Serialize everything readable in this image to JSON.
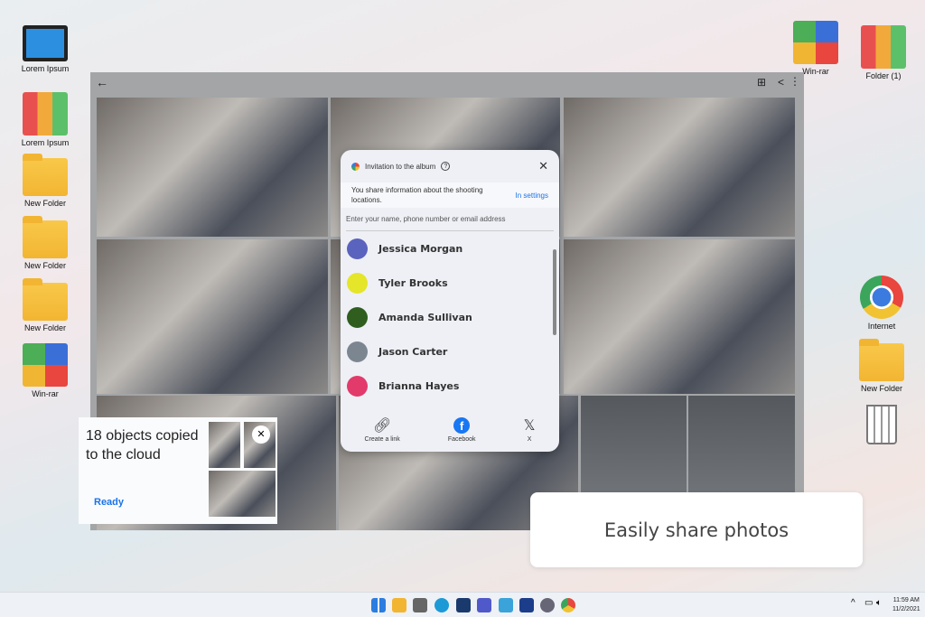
{
  "desktop": {
    "left": [
      {
        "label": "Lorem Ipsum",
        "icon": "computer-icon"
      },
      {
        "label": "Lorem Ipsum",
        "icon": "binders-icon"
      },
      {
        "label": "New Folder",
        "icon": "folder-icon"
      },
      {
        "label": "New Folder",
        "icon": "folder-icon"
      },
      {
        "label": "New Folder",
        "icon": "folder-icon"
      },
      {
        "label": "Win-rar",
        "icon": "winrar-icon"
      }
    ],
    "right": [
      {
        "label": "Win-rar"
      },
      {
        "label": "Folder (1)"
      },
      {
        "label": "Internet"
      },
      {
        "label": "New Folder"
      }
    ]
  },
  "dialog": {
    "title": "Invitation to the album",
    "info": "You share information about the shooting locations.",
    "settings_link": "In settings",
    "input_placeholder": "Enter your name, phone number or email address",
    "contacts": [
      {
        "name": "Jessica Morgan",
        "color": "#5a63bd"
      },
      {
        "name": "Tyler Brooks",
        "color": "#e5e52a"
      },
      {
        "name": "Amanda Sullivan",
        "color": "#2f5e1e"
      },
      {
        "name": "Jason Carter",
        "color": "#7c8690"
      },
      {
        "name": "Brianna Hayes",
        "color": "#e23a6b"
      }
    ],
    "share": [
      {
        "label": "Create a link"
      },
      {
        "label": "Facebook"
      },
      {
        "label": "X"
      }
    ]
  },
  "toast": {
    "message": "18 objects copied to the cloud",
    "action": "Ready"
  },
  "caption": "Easily share photos",
  "clock": {
    "time": "11:59 AM",
    "date": "11/2/2021"
  }
}
